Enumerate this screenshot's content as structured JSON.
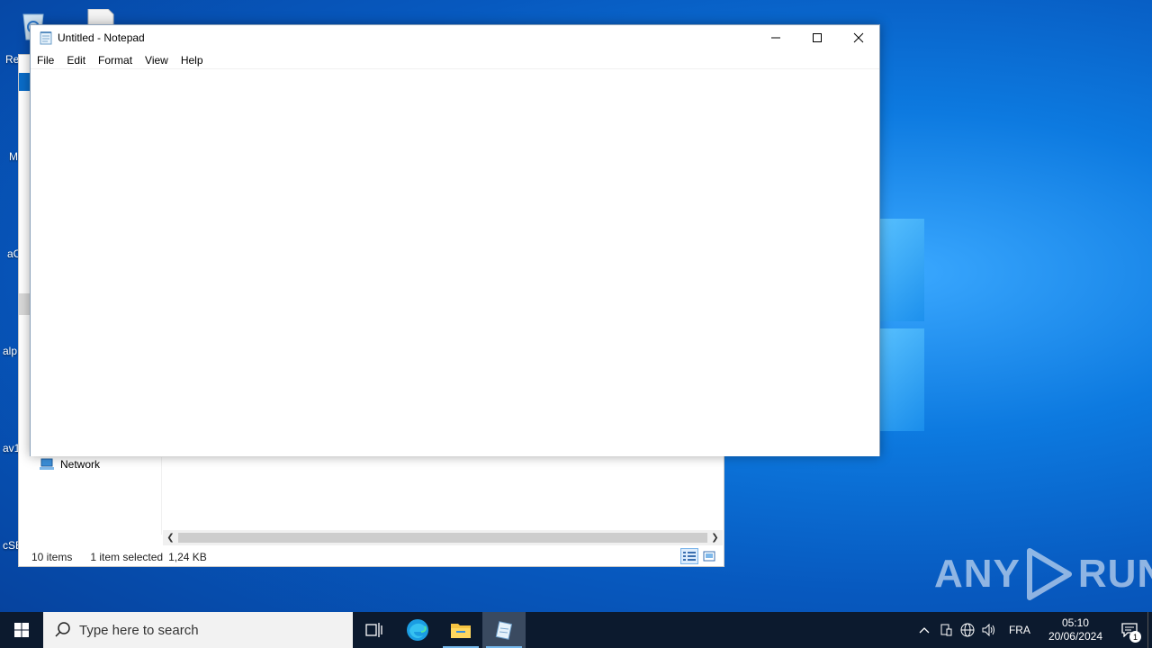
{
  "desktop": {
    "icon_labels": [
      "Re",
      "M",
      "aC",
      "alp",
      "av1",
      "cSE"
    ]
  },
  "explorer": {
    "nav_network_label": "Network",
    "status_items": "10 items",
    "status_selected": "1 item selected",
    "status_size": "1,24 KB"
  },
  "notepad": {
    "title": "Untitled - Notepad",
    "menu": [
      "File",
      "Edit",
      "Format",
      "View",
      "Help"
    ],
    "content": ""
  },
  "watermark": {
    "text_left": "ANY",
    "text_right": "RUN"
  },
  "taskbar": {
    "search_placeholder": "Type here to search",
    "language": "FRA",
    "time": "05:10",
    "date": "20/06/2024",
    "notification_count": "1"
  },
  "colors": {
    "taskbar_bg": "#0c1a2e",
    "accent": "#76b9ed",
    "desktop_blue": "#0d7ae0"
  }
}
